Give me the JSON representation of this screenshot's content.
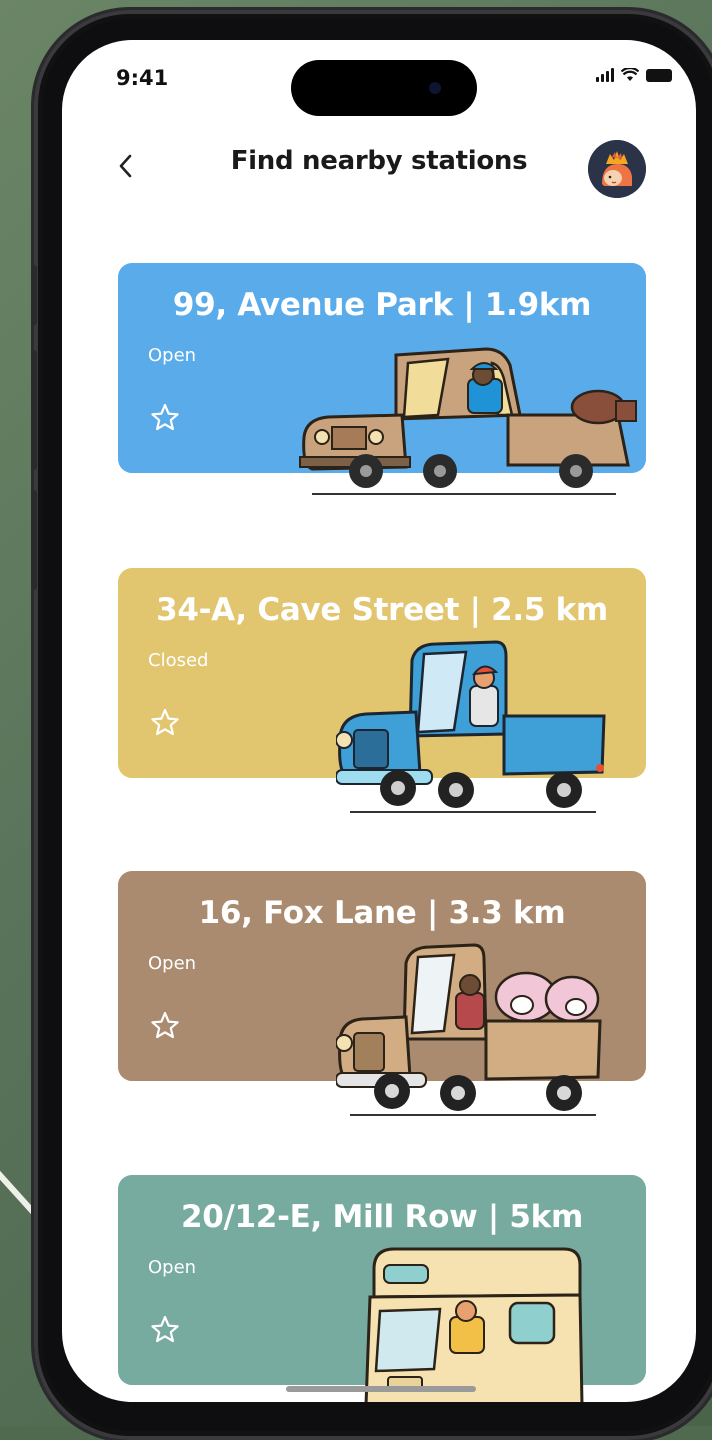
{
  "status_bar": {
    "time": "9:41"
  },
  "header": {
    "title": "Find nearby stations",
    "back_icon": "chevron-left-icon",
    "avatar_icon": "avatar-icon"
  },
  "stations": [
    {
      "title": "99, Avenue Park | 1.9km",
      "status": "Open",
      "color": "#5aabea",
      "vehicle": "tan-pickup-truck"
    },
    {
      "title": "34-A, Cave Street | 2.5 km",
      "status": "Closed",
      "color": "#e2c56f",
      "vehicle": "blue-pickup-truck"
    },
    {
      "title": "16, Fox Lane | 3.3 km",
      "status": "Open",
      "color": "#ab8b70",
      "vehicle": "sheep-truck"
    },
    {
      "title": "20/12-E, Mill Row | 5km",
      "status": "Open",
      "color": "#77ab9f",
      "vehicle": "camper-van"
    }
  ]
}
